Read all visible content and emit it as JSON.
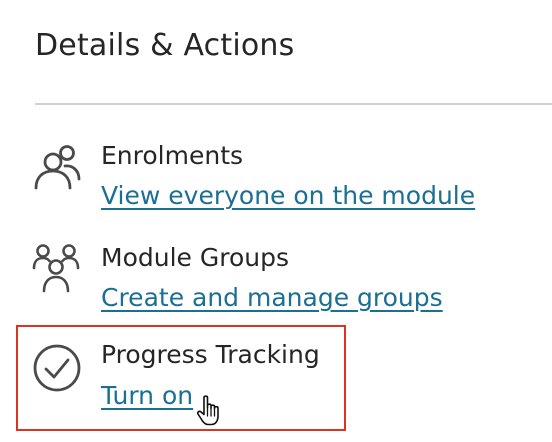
{
  "panel": {
    "title": "Details & Actions"
  },
  "items": [
    {
      "icon": "enrolments-icon",
      "heading": "Enrolments",
      "link": "View everyone on the module"
    },
    {
      "icon": "module-groups-icon",
      "heading": "Module Groups",
      "link": "Create and manage groups"
    },
    {
      "icon": "progress-check-icon",
      "heading": "Progress Tracking",
      "link": "Turn on"
    }
  ],
  "colors": {
    "text": "#262626",
    "link": "#1a6f93",
    "icon": "#4a4a4a",
    "divider": "#d1d1d1",
    "highlight": "#dd3320"
  },
  "cursor": "hand-pointer-icon"
}
